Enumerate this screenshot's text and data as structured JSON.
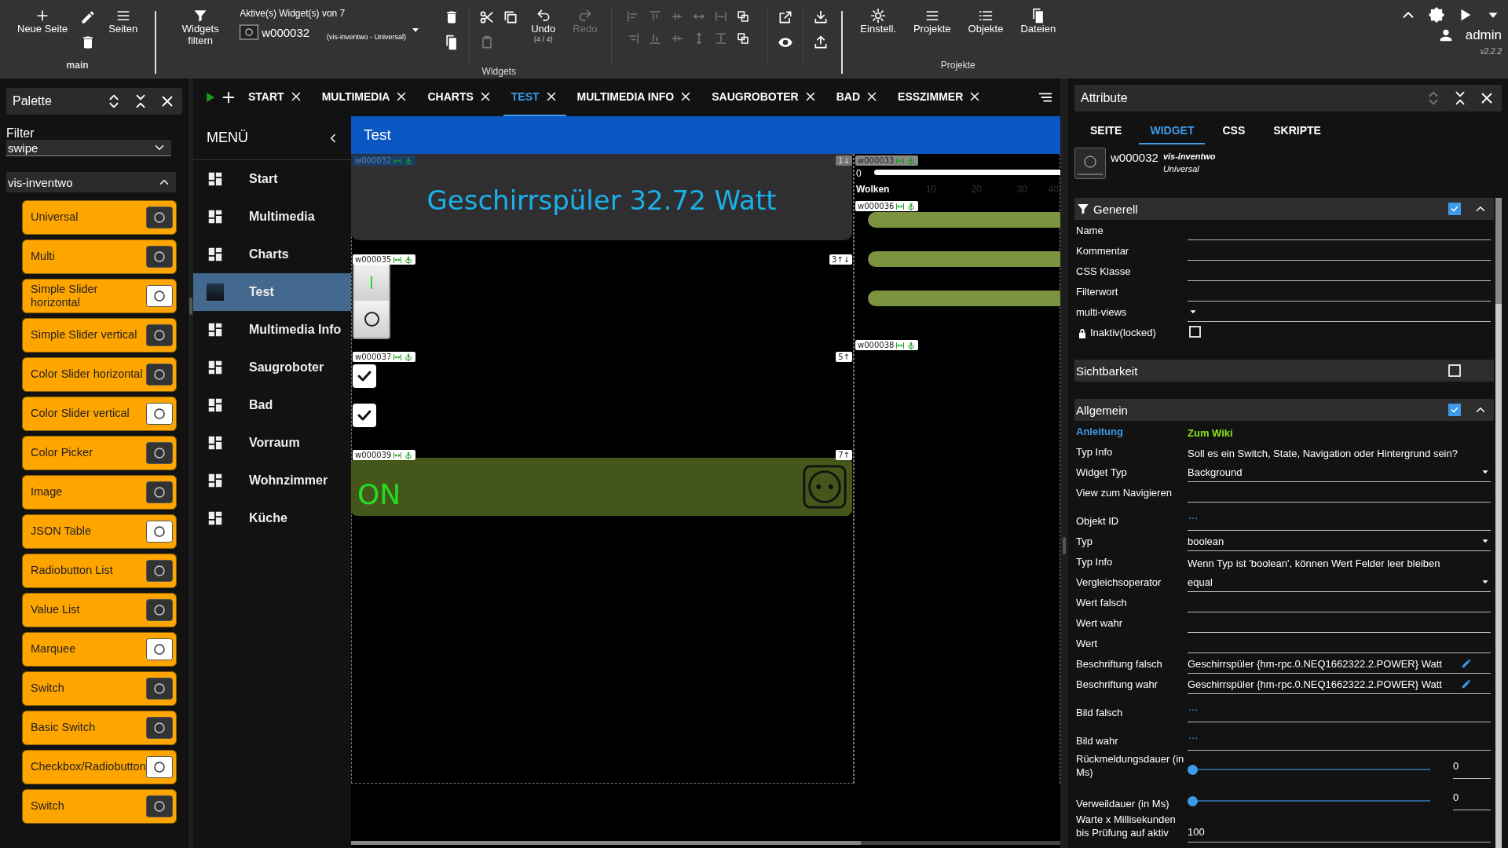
{
  "toolbar": {
    "new_page": "Neue Seite",
    "pages": "Seiten",
    "main_label": "main",
    "filter_widgets": "Widgets filtern",
    "active_title": "Aktive(s) Widget(s) von 7",
    "active_id": "w000032",
    "active_type": "(vis-inventwo - Universal)",
    "undo": {
      "label": "Undo",
      "counter": "(4 / 4)",
      "disabled": false
    },
    "redo": {
      "label": "Redo",
      "disabled": true
    },
    "widgets_label": "Widgets",
    "project_buttons": [
      "Einstell.",
      "Projekte",
      "Objekte",
      "Dateien"
    ],
    "projects_label": "Projekte",
    "user": "admin",
    "version": "v2.2.2"
  },
  "palette": {
    "title": "Palette",
    "filter_label": "Filter",
    "filter_value": "swipe",
    "group": {
      "label": "vis-inventwo",
      "expanded": true
    },
    "items": [
      "Universal",
      "Multi",
      "Simple Slider horizontal",
      "Simple Slider vertical",
      "Color Slider horizontal",
      "Color Slider vertical",
      "Color Picker",
      "Image",
      "JSON Table",
      "Radiobutton List",
      "Value List",
      "Marquee",
      "Switch",
      "Basic Switch",
      "Checkbox/Radiobutton",
      "Switch"
    ]
  },
  "tabs": [
    {
      "label": "START",
      "selected": false
    },
    {
      "label": "MULTIMEDIA",
      "selected": false
    },
    {
      "label": "CHARTS",
      "selected": false
    },
    {
      "label": "TEST",
      "selected": true
    },
    {
      "label": "MULTIMEDIA INFO",
      "selected": false
    },
    {
      "label": "SAUGROBOTER",
      "selected": false
    },
    {
      "label": "BAD",
      "selected": false
    },
    {
      "label": "ESSZIMMER",
      "selected": false
    }
  ],
  "menu": {
    "title": "MENÜ",
    "items": [
      {
        "label": "Start",
        "selected": false
      },
      {
        "label": "Multimedia",
        "selected": false
      },
      {
        "label": "Charts",
        "selected": false
      },
      {
        "label": "Test",
        "selected": true
      },
      {
        "label": "Multimedia Info",
        "selected": false
      },
      {
        "label": "Saugroboter",
        "selected": false
      },
      {
        "label": "Bad",
        "selected": false
      },
      {
        "label": "Vorraum",
        "selected": false
      },
      {
        "label": "Wohnzimmer",
        "selected": false
      },
      {
        "label": "Küche",
        "selected": false
      }
    ]
  },
  "canvas": {
    "title": "Test",
    "widgets": [
      {
        "kind": "label",
        "id": "w000032",
        "order": "1↓",
        "selected": true,
        "text": "Geschirrspüler 32.72 Watt"
      },
      {
        "kind": "toggle",
        "id": "w000035",
        "order": "3↑↓",
        "selected": false,
        "on": true
      },
      {
        "kind": "checkboxes",
        "id": "w000037",
        "order": "5↑",
        "selected": false,
        "items": [
          {
            "checked": true
          },
          {
            "checked": true
          }
        ]
      },
      {
        "kind": "button",
        "id": "w000039",
        "order": "7↑",
        "selected": false,
        "text": "ON"
      }
    ],
    "side_widgets": [
      {
        "kind": "slider",
        "id": "w000033",
        "value": "0",
        "label": "Wolken",
        "ticks": [
          "10",
          "20",
          "30",
          "40"
        ]
      },
      {
        "kind": "bars",
        "id": "w000036"
      },
      {
        "kind": "empty",
        "id": "w000038"
      }
    ]
  },
  "attributes": {
    "title": "Attribute",
    "tabs": [
      {
        "label": "SEITE",
        "selected": false
      },
      {
        "label": "WIDGET",
        "selected": true
      },
      {
        "label": "CSS",
        "selected": false
      },
      {
        "label": "SKRIPTE",
        "selected": false
      }
    ],
    "widget": {
      "id": "w000032",
      "set": "vis-inventwo",
      "name": "Universal"
    },
    "sections": [
      {
        "title": "Generell",
        "filter": true,
        "checked": true,
        "expanded": true,
        "fields": [
          {
            "kind": "text",
            "label": "Name"
          },
          {
            "kind": "text",
            "label": "Kommentar"
          },
          {
            "kind": "text",
            "label": "CSS Klasse"
          },
          {
            "kind": "text",
            "label": "Filterwort"
          },
          {
            "kind": "select",
            "label": "multi-views"
          },
          {
            "kind": "checkbox",
            "label": "Inaktiv(locked)",
            "locked": true,
            "checked": false
          }
        ]
      },
      {
        "title": "Sichtbarkeit",
        "filter": false,
        "checked": false,
        "expanded": false
      },
      {
        "title": "Allgemein",
        "filter": false,
        "checked": true,
        "expanded": true,
        "fields": [
          {
            "kind": "link",
            "label": "Anleitung",
            "value": "Zum Wiki"
          },
          {
            "kind": "info",
            "label": "Typ Info",
            "value": "Soll es ein Switch, State, Navigation oder Hintergrund sein?"
          },
          {
            "kind": "select",
            "label": "Widget Typ",
            "value": "Background"
          },
          {
            "kind": "text",
            "label": "View zum Navigieren"
          },
          {
            "kind": "picker",
            "label": "Objekt ID"
          },
          {
            "kind": "select",
            "label": "Typ",
            "value": "boolean"
          },
          {
            "kind": "info",
            "label": "Typ Info",
            "value": "Wenn Typ ist 'boolean', können Wert Felder leer bleiben"
          },
          {
            "kind": "select",
            "label": "Vergleichsoperator",
            "value": "equal"
          },
          {
            "kind": "text",
            "label": "Wert falsch"
          },
          {
            "kind": "text",
            "label": "Wert wahr"
          },
          {
            "kind": "text",
            "label": "Wert"
          },
          {
            "kind": "edit",
            "label": "Beschriftung falsch",
            "value": "Geschirrspüler {hm-rpc.0.NEQ1662322.2.POWER} Watt"
          },
          {
            "kind": "edit",
            "label": "Beschriftung wahr",
            "value": "Geschirrspüler {hm-rpc.0.NEQ1662322.2.POWER} Watt"
          },
          {
            "kind": "picker",
            "label": "Bild falsch"
          },
          {
            "kind": "picker",
            "label": "Bild wahr"
          },
          {
            "kind": "slider",
            "label": "Rückmeldungsdauer (in Ms)",
            "level": 0,
            "value": "0"
          },
          {
            "kind": "slider",
            "label": "Verweildauer (in Ms)",
            "level": 0,
            "value": "0"
          },
          {
            "kind": "text",
            "label": "Warte x Millisekunden bis Prüfung auf aktiv",
            "value": "100"
          }
        ]
      }
    ]
  }
}
